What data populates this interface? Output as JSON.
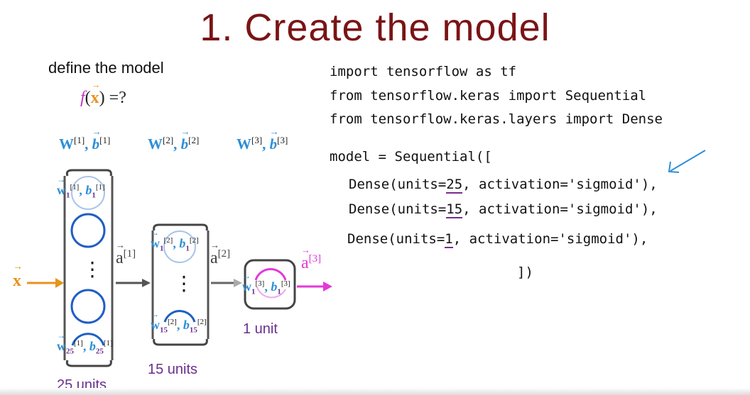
{
  "title": "1. Create the model",
  "define_label": "define the model",
  "function": {
    "f": "f",
    "x": "x",
    "rest": ") =?"
  },
  "params": [
    {
      "W": "W",
      "sup_w": "[1]",
      "b": "b",
      "sup_b": "[1]"
    },
    {
      "W": "W",
      "sup_w": "[2]",
      "b": "b",
      "sup_b": "[2]"
    },
    {
      "W": "W",
      "sup_w": "[3]",
      "b": "b",
      "sup_b": "[3]"
    }
  ],
  "code": {
    "line1": "import tensorflow as tf",
    "line2": "from tensorflow.keras import Sequential",
    "line3": "from tensorflow.keras.layers import Dense",
    "line4": "model = Sequential([",
    "dense1_a": "Dense(units=",
    "dense1_n": "25",
    "dense1_b": ", activation='sigmoid'),",
    "dense2_a": "Dense(units=",
    "dense2_n": "15",
    "dense2_b": ", activation='sigmoid'),",
    "dense3_a": "Dense(units=",
    "dense3_n": "1",
    "dense3_b": ", activation='sigmoid'),",
    "close": "])"
  },
  "network": {
    "input_label": "x",
    "layer1": {
      "top": {
        "w": "w",
        "sub": "1",
        "sup": "[1]",
        "b": "b"
      },
      "bottom": {
        "w": "w",
        "sub": "25",
        "sup": "[1]",
        "b": "b"
      },
      "units": "25 units"
    },
    "layer2": {
      "top": {
        "w": "w",
        "sub": "1",
        "sup": "[2]",
        "b": "b"
      },
      "bottom": {
        "w": "w",
        "sub": "15",
        "sup": "[2]",
        "b": "b"
      },
      "units": "15 units"
    },
    "layer3": {
      "top": {
        "w": "w",
        "sub": "1",
        "sup": "[3]",
        "b": "b"
      },
      "units": "1 unit"
    },
    "a1": {
      "a": "a",
      "sup": "[1]"
    },
    "a2": {
      "a": "a",
      "sup": "[2]"
    },
    "a3": {
      "a": "a",
      "sup": "[3]"
    },
    "dots": "⋮"
  },
  "colors": {
    "title": "#7a1416",
    "blue": "#2e8fd6",
    "purple": "#6a2f8f",
    "orange": "#e8931b",
    "magenta": "#e23ad8",
    "neuron": "#1f5fc4"
  }
}
